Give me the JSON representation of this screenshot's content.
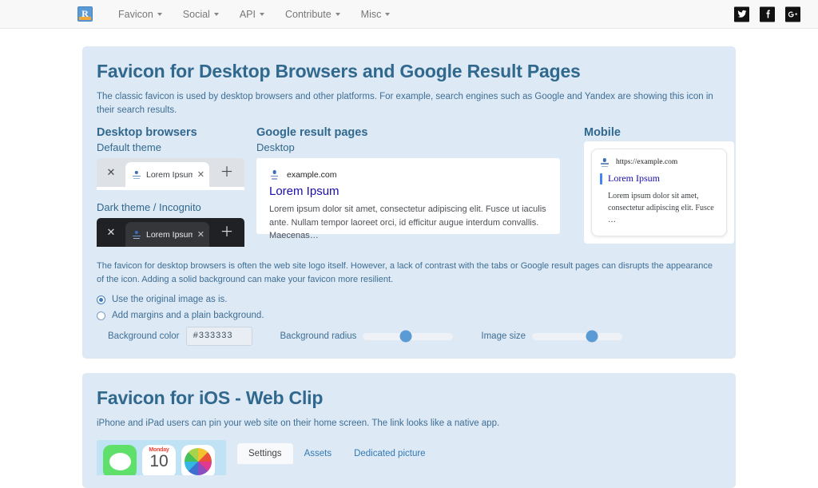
{
  "navbar": {
    "logo_letter": "R",
    "items": [
      {
        "label": "Favicon",
        "has_caret": true
      },
      {
        "label": "Social",
        "has_caret": true
      },
      {
        "label": "API",
        "has_caret": true
      },
      {
        "label": "Contribute",
        "has_caret": true
      },
      {
        "label": "Misc",
        "has_caret": true
      }
    ],
    "social": [
      {
        "name": "twitter-icon"
      },
      {
        "name": "facebook-icon"
      },
      {
        "name": "google-plus-icon"
      }
    ]
  },
  "desktop_panel": {
    "title": "Favicon for Desktop Browsers and Google Result Pages",
    "subtitle": "The classic favicon is used by desktop browsers and other platforms. For example, search engines such as Google and Yandex are showing this icon in their search results.",
    "desktop_browsers": {
      "heading": "Desktop browsers",
      "default_theme_label": "Default theme",
      "dark_theme_label": "Dark theme / Incognito",
      "tab_title": "Lorem Ipsum",
      "close_glyph": "✕",
      "new_tab_glyph": "＋"
    },
    "google": {
      "heading": "Google result pages",
      "desktop_label": "Desktop",
      "mobile_label": "Mobile",
      "desktop_result": {
        "url": "example.com",
        "title": "Lorem Ipsum",
        "snippet": "Lorem ipsum dolor sit amet, consectetur adipiscing elit. Fusce ut iaculis ante. Nullam tempor laoreet orci, id efficitur augue interdum convallis. Maecenas…"
      },
      "mobile_result": {
        "url": "https://example.com",
        "title": "Lorem Ipsum",
        "snippet": "Lorem ipsum dolor sit amet, consectetur adipiscing elit. Fusce …"
      }
    },
    "options": {
      "note": "The favicon for desktop browsers is often the web site logo itself. However, a lack of contrast with the tabs or Google result pages can disrupts the appearance of the icon. Adding a solid background can make your favicon more resilient.",
      "radio_original": {
        "label": "Use the original image as is.",
        "selected": true
      },
      "radio_margins": {
        "label": "Add margins and a plain background.",
        "selected": false
      },
      "background_color": {
        "label": "Background color",
        "value": "#333333"
      },
      "background_radius": {
        "label": "Background radius",
        "percent": 47
      },
      "image_size": {
        "label": "Image size",
        "percent": 66
      }
    }
  },
  "ios_panel": {
    "title": "Favicon for iOS - Web Clip",
    "subtitle": "iPhone and iPad users can pin your web site on their home screen. The link looks like a native app.",
    "home_icons": {
      "calendar_day": "Monday",
      "calendar_date": "10"
    },
    "tabs": [
      {
        "label": "Settings",
        "active": true
      },
      {
        "label": "Assets",
        "active": false
      },
      {
        "label": "Dedicated picture",
        "active": false
      }
    ]
  }
}
